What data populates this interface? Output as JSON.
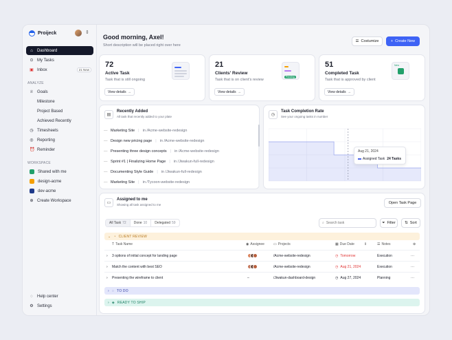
{
  "app": {
    "name": "Proijeck"
  },
  "sidebar": {
    "items": [
      {
        "label": "Dashboard",
        "icon": "home-icon"
      },
      {
        "label": "My Tasks",
        "icon": "check-circle-icon"
      },
      {
        "label": "Inbox",
        "icon": "inbox-icon",
        "badge": "21 New"
      }
    ],
    "analyze_label": "ANALYZE",
    "analyze": [
      {
        "label": "Goals",
        "icon": "trophy-icon"
      },
      {
        "label": "Milestone"
      },
      {
        "label": "Project Based"
      },
      {
        "label": "Achieved Recently"
      },
      {
        "label": "Timesheets",
        "icon": "clock-icon"
      },
      {
        "label": "Reporting",
        "icon": "report-icon"
      },
      {
        "label": "Reminder",
        "icon": "alarm-icon"
      }
    ],
    "workspace_label": "WORKSPACE",
    "workspaces": [
      {
        "label": "Shared with me",
        "color": "#22a06b"
      },
      {
        "label": "design-acme",
        "color": "#f59f00"
      },
      {
        "label": "dev-acme",
        "color": "#1f3a8a"
      },
      {
        "label": "Create Workspace",
        "icon": "plus-circle-icon"
      }
    ],
    "help": "Help center",
    "settings": "Settings"
  },
  "header": {
    "greeting": "Good morning, Axel!",
    "subtitle": "Short description will be placed right over here",
    "customize": "Costumize",
    "create": "Create New"
  },
  "stats": [
    {
      "value": "72",
      "title": "Active Task",
      "desc": "Task that is still ongoing",
      "button": "View details"
    },
    {
      "value": "21",
      "title": "Clients' Review",
      "desc": "Task that is on client's review",
      "button": "View details"
    },
    {
      "value": "51",
      "title": "Completed Task",
      "desc": "Task that is approved by client",
      "button": "View details"
    }
  ],
  "mini_badges": {
    "pending": "Pending",
    "new": "New"
  },
  "recent": {
    "title": "Recently Added",
    "subtitle": "All task that recently added to your plate",
    "items": [
      {
        "name": "Marketing Site",
        "path": "in /Acme-website-redesign"
      },
      {
        "name": "Design new pricing page",
        "path": "in /Acme-website-redesign"
      },
      {
        "name": "Presenting three design concepts",
        "path": "in /Acme-website-redesign"
      },
      {
        "name": "Sprint #1 | Finalizing Home Page",
        "path": "in /Jiwakun-full-redesign"
      },
      {
        "name": "Documenting Style Guide",
        "path": "in /Jiwakun-full-redesign"
      },
      {
        "name": "Marketing Site",
        "path": "in /Tycoon-website-redesign"
      }
    ]
  },
  "completion": {
    "title": "Task Completion Rate",
    "subtitle": "See your ongoing tasks in number",
    "tooltip_date": "Aug 21, 2024",
    "tooltip_label": "Assigned Task",
    "tooltip_value": "24 Tasks",
    "color": "#4c63e6"
  },
  "chart_data": {
    "type": "area",
    "x": [
      0,
      1,
      2,
      3,
      4,
      5,
      6,
      7
    ],
    "values": [
      6,
      6,
      6,
      4,
      4,
      2,
      2,
      2
    ],
    "highlight": {
      "date": "Aug 21, 2024",
      "series": "Assigned Task",
      "value": 24
    }
  },
  "assigned": {
    "title": "Assigned to me",
    "subtitle": "Showing all task assigned to me",
    "open_page": "Open Task Page",
    "tabs": [
      {
        "label": "All Task",
        "count": "72"
      },
      {
        "label": "Done",
        "count": "10"
      },
      {
        "label": "Delegated",
        "count": "59"
      }
    ],
    "search_placeholder": "Search task",
    "filter": "Filter",
    "sort": "Sort",
    "columns": {
      "name": "Task Name",
      "assignee": "Assignee",
      "projects": "Projects",
      "due": "Due Date",
      "notes": "Notes"
    },
    "groups": {
      "review": "CLIENT REVIEW",
      "todo": "TO DO",
      "ready": "READY TO SHIP"
    },
    "rows": [
      {
        "name": "3 options of initial concept for landing page",
        "project": "/Acme-website-redesign",
        "due": "Tomorrow",
        "overdue": true,
        "notes": "Execution"
      },
      {
        "name": "Match the content with best SEO",
        "project": "/Acme-website-redesign",
        "due": "Aug 21, 2024",
        "overdue": true,
        "notes": "Execution"
      },
      {
        "name": "Presenting the wireframe to client",
        "assignee": "–",
        "project": "/Jiwakun-dashboard-design",
        "due": "Aug 27, 2024",
        "overdue": false,
        "notes": "Planning"
      }
    ]
  }
}
